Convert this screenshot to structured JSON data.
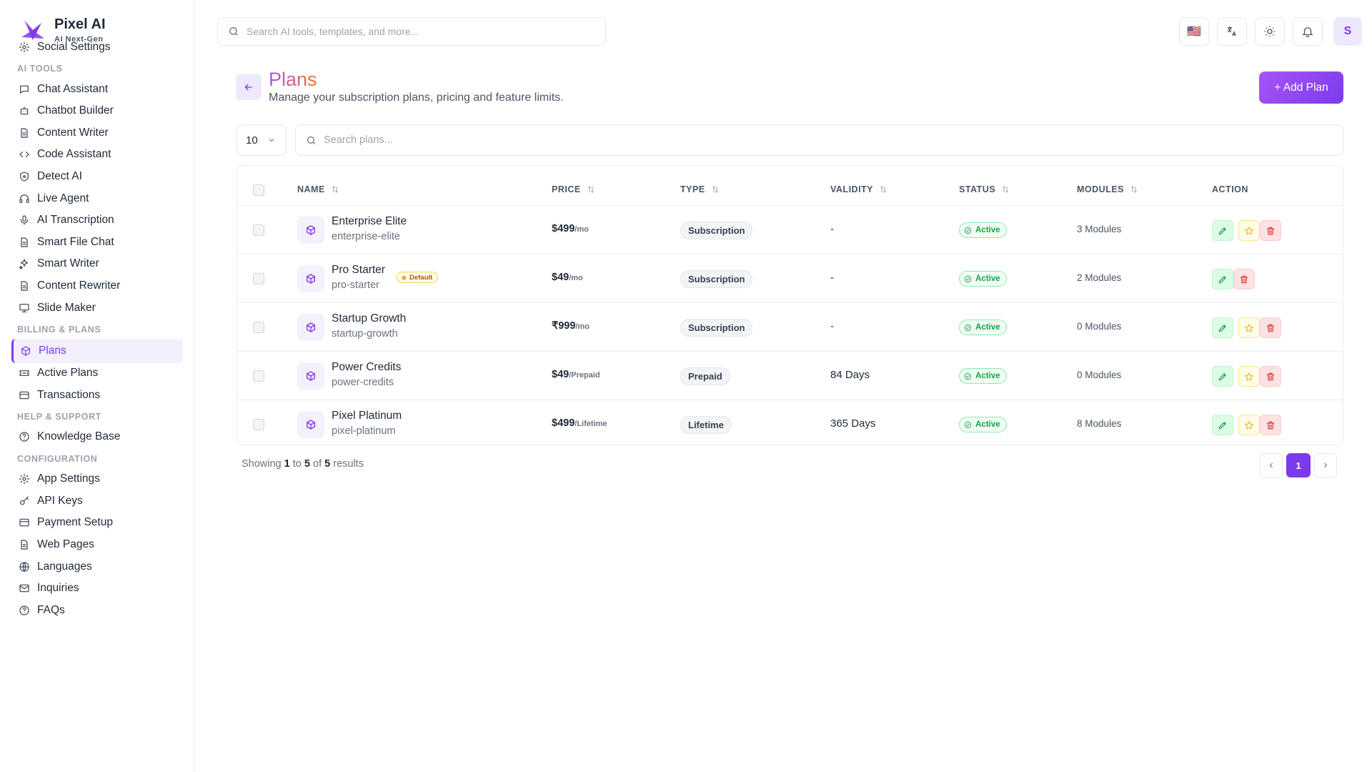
{
  "brand": {
    "name": "Pixel AI",
    "subtitle": "AI Next-Gen"
  },
  "sidebar": {
    "partial_item": {
      "label": "Social Settings",
      "icon": "gear-icon"
    },
    "sections": [
      {
        "label": "AI TOOLS",
        "items": [
          {
            "label": "Chat Assistant",
            "icon": "chat-bubble-icon"
          },
          {
            "label": "Chatbot Builder",
            "icon": "bot-icon"
          },
          {
            "label": "Content Writer",
            "icon": "document-icon"
          },
          {
            "label": "Code Assistant",
            "icon": "code-icon"
          },
          {
            "label": "Detect AI",
            "icon": "shield-icon"
          },
          {
            "label": "Live Agent",
            "icon": "headset-icon"
          },
          {
            "label": "AI Transcription",
            "icon": "microphone-icon"
          },
          {
            "label": "Smart File Chat",
            "icon": "document-icon"
          },
          {
            "label": "Smart Writer",
            "icon": "sparkles-icon"
          },
          {
            "label": "Content Rewriter",
            "icon": "document-icon"
          },
          {
            "label": "Slide Maker",
            "icon": "presentation-icon"
          }
        ]
      },
      {
        "label": "BILLING & PLANS",
        "items": [
          {
            "label": "Plans",
            "icon": "box-icon",
            "active": true
          },
          {
            "label": "Active Plans",
            "icon": "ticket-icon"
          },
          {
            "label": "Transactions",
            "icon": "credit-card-icon"
          }
        ]
      },
      {
        "label": "HELP & SUPPORT",
        "items": [
          {
            "label": "Knowledge Base",
            "icon": "help-circle-icon"
          }
        ]
      },
      {
        "label": "CONFIGURATION",
        "items": [
          {
            "label": "App Settings",
            "icon": "gear-icon"
          },
          {
            "label": "API Keys",
            "icon": "key-icon"
          },
          {
            "label": "Payment Setup",
            "icon": "credit-card-icon"
          },
          {
            "label": "Web Pages",
            "icon": "document-icon"
          },
          {
            "label": "Languages",
            "icon": "globe-icon"
          },
          {
            "label": "Inquiries",
            "icon": "mail-icon"
          },
          {
            "label": "FAQs",
            "icon": "help-circle-icon"
          }
        ]
      }
    ]
  },
  "topbar": {
    "search_placeholder": "Search AI tools, templates, and more...",
    "language_flag": "🇺🇸",
    "avatar_initial": "S"
  },
  "page": {
    "title": "Plans",
    "subtitle": "Manage your subscription plans, pricing and feature limits.",
    "add_button": "+ Add Plan"
  },
  "filters": {
    "per_page": "10",
    "search_placeholder": "Search plans..."
  },
  "table": {
    "columns": [
      "NAME",
      "PRICE",
      "TYPE",
      "VALIDITY",
      "STATUS",
      "MODULES",
      "ACTION"
    ],
    "default_label": "Default",
    "rows": [
      {
        "name": "Enterprise Elite",
        "slug": "enterprise-elite",
        "price": "$499",
        "period": "/mo",
        "type": "Subscription",
        "validity": "-",
        "status": "Active",
        "modules": "3 Modules",
        "default": false,
        "star": true
      },
      {
        "name": "Pro Starter",
        "slug": "pro-starter",
        "price": "$49",
        "period": "/mo",
        "type": "Subscription",
        "validity": "-",
        "status": "Active",
        "modules": "2 Modules",
        "default": true,
        "star": false
      },
      {
        "name": "Startup Growth",
        "slug": "startup-growth",
        "price": "₹999",
        "period": "/mo",
        "type": "Subscription",
        "validity": "-",
        "status": "Active",
        "modules": "0 Modules",
        "default": false,
        "star": true
      },
      {
        "name": "Power Credits",
        "slug": "power-credits",
        "price": "$49",
        "period": "/Prepaid",
        "type": "Prepaid",
        "validity": "84 Days",
        "status": "Active",
        "modules": "0 Modules",
        "default": false,
        "star": true
      },
      {
        "name": "Pixel Platinum",
        "slug": "pixel-platinum",
        "price": "$499",
        "period": "/Lifetime",
        "type": "Lifetime",
        "validity": "365 Days",
        "status": "Active",
        "modules": "8 Modules",
        "default": false,
        "star": true
      }
    ]
  },
  "footer": {
    "showing_prefix": "Showing",
    "from": "1",
    "to_word": "to",
    "to": "5",
    "of_word": "of",
    "total": "5",
    "results_word": "results",
    "current_page": "1"
  },
  "colors": {
    "accent": "#7c3aed",
    "success": "#16a34a",
    "danger": "#dc2626",
    "warning": "#eab308"
  }
}
